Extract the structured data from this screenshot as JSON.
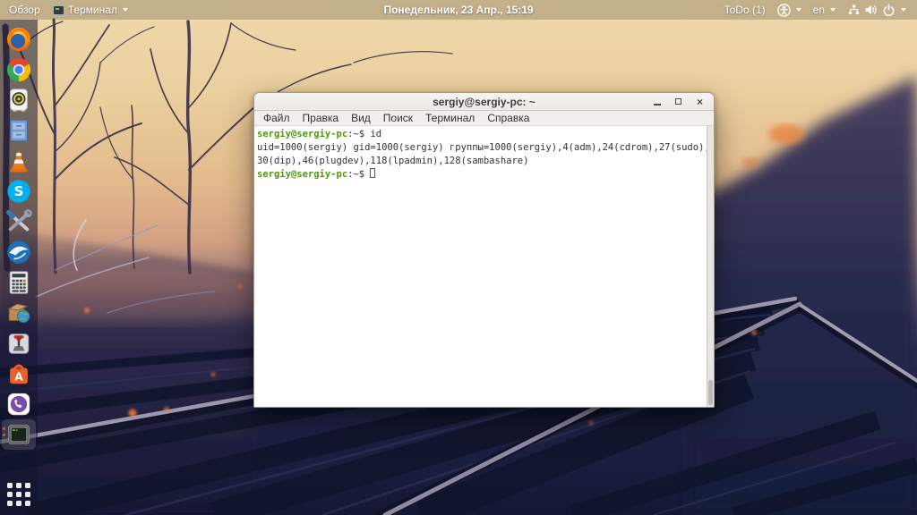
{
  "topbar": {
    "activities": "Обзор",
    "app_menu": {
      "label": "Терминал",
      "icon": "terminal-mini-icon"
    },
    "clock": "Понедельник, 23 Апр., 15:19",
    "todo": "ToDo (1)",
    "language": "en",
    "status_icons": [
      "accessibility-icon",
      "network-wired-icon",
      "volume-icon",
      "power-icon"
    ]
  },
  "dock": {
    "items": [
      {
        "name": "firefox"
      },
      {
        "name": "chrome"
      },
      {
        "name": "backups"
      },
      {
        "name": "files"
      },
      {
        "name": "vlc"
      },
      {
        "name": "skype"
      },
      {
        "name": "system-tools"
      },
      {
        "name": "thunderbird"
      },
      {
        "name": "calculator"
      },
      {
        "name": "package-manager"
      },
      {
        "name": "controller-settings"
      },
      {
        "name": "software-center"
      },
      {
        "name": "viber"
      },
      {
        "name": "terminal",
        "active": true,
        "running_indicators": 2
      }
    ],
    "show_apps": "show-applications-grid"
  },
  "window": {
    "title": "sergiy@sergiy-pc: ~",
    "controls": [
      "minimize",
      "maximize",
      "close"
    ],
    "menu": [
      "Файл",
      "Правка",
      "Вид",
      "Поиск",
      "Терминал",
      "Справка"
    ],
    "terminal": {
      "line1": {
        "user": "sergiy@sergiy-pc",
        "suffix": ":~$ ",
        "command": "id"
      },
      "line2": "uid=1000(sergiy) gid=1000(sergiy) группы=1000(sergiy),4(adm),24(cdrom),27(sudo),",
      "line3": "30(dip),46(plugdev),118(lpadmin),128(sambashare)",
      "line4": {
        "user": "sergiy@sergiy-pc",
        "suffix": ":~$ "
      }
    }
  },
  "colors": {
    "prompt_green": "#4e9a06",
    "ubuntu_orange": "#e95420",
    "sky_beige": "#eed9ab",
    "track_navy": "#1d2142"
  }
}
